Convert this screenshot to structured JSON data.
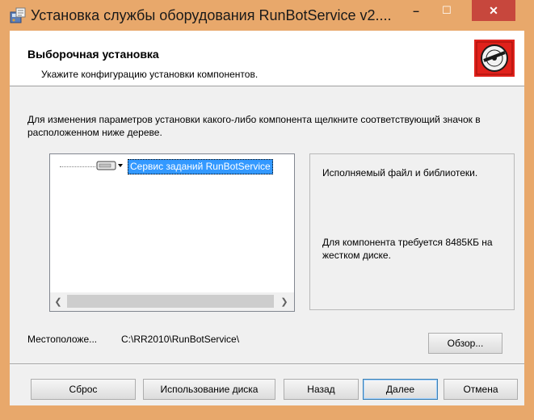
{
  "window": {
    "title": "Установка службы оборудования RunBotService v2....",
    "minimize_glyph": "–",
    "maximize_glyph": "☐",
    "close_glyph": "✕",
    "title_icon": "installer-icon",
    "frame_color": "#e8a86b",
    "close_color": "#c7473d"
  },
  "header": {
    "title": "Выборочная установка",
    "subtitle": "Укажите конфигурацию установки компонентов.",
    "logo_icon": "disc-logo-icon",
    "logo_color": "#e0211b"
  },
  "description": "Для изменения параметров установки какого-либо компонента щелкните соответствующий значок в расположенном ниже дереве.",
  "tree": {
    "node_icon": "drive-dropdown-icon",
    "item_label": "Сервис заданий RunBotService",
    "selection_color": "#3399ff",
    "scroll_left_glyph": "❮",
    "scroll_right_glyph": "❯"
  },
  "info": {
    "description": "Исполняемый файл и библиотеки.",
    "size_text": "Для компонента требуется 8485КБ на жестком диске."
  },
  "location": {
    "label": "Местоположе...",
    "path": "C:\\RR2010\\RunBotService\\"
  },
  "buttons": {
    "browse": "Обзор...",
    "reset": "Сброс",
    "disk_usage": "Использование диска",
    "back": "Назад",
    "next": "Далее",
    "cancel": "Отмена"
  }
}
